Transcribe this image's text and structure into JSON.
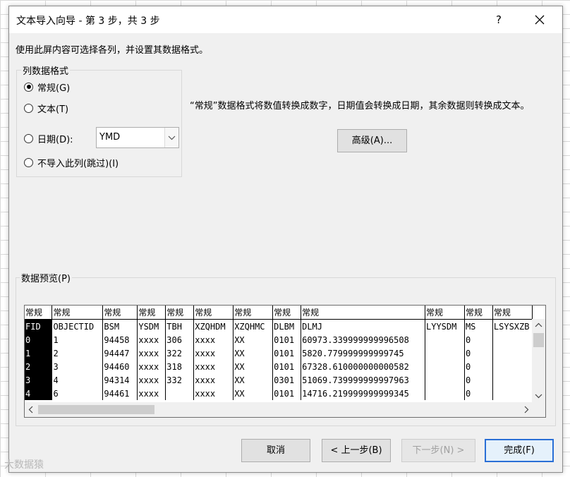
{
  "dialog": {
    "title": "文本导入向导 - 第 3 步，共 3 步",
    "help": "?",
    "intro": "使用此屏内容可选择各列，并设置其数据格式。"
  },
  "format_group": {
    "title": "列数据格式",
    "options": [
      {
        "label": "常规(G)",
        "selected": true
      },
      {
        "label": "文本(T)",
        "selected": false
      },
      {
        "label": "日期(D):",
        "selected": false
      },
      {
        "label": "不导入此列(跳过)(I)",
        "selected": false
      }
    ],
    "date_format": "YMD"
  },
  "description": "“常规”数据格式将数值转换成数字，日期值会转换成日期，其余数据则转换成文本。",
  "advanced_button": "高级(A)...",
  "preview": {
    "title": "数据预览(P)",
    "columns": [
      {
        "type": "常规",
        "name": "FID"
      },
      {
        "type": "常规",
        "name": "OBJECTID"
      },
      {
        "type": "常规",
        "name": "BSM"
      },
      {
        "type": "常规",
        "name": "YSDM"
      },
      {
        "type": "常规",
        "name": "TBH"
      },
      {
        "type": "常规",
        "name": "XZQHDM"
      },
      {
        "type": "常规",
        "name": "XZQHMC"
      },
      {
        "type": "常规",
        "name": "DLBM"
      },
      {
        "type": "常规",
        "name": "DLMJ"
      },
      {
        "type": "常规",
        "name": "LYYSDM"
      },
      {
        "type": "常规",
        "name": "MS"
      },
      {
        "type": "常规",
        "name": "LSYSXZB"
      }
    ],
    "rows": [
      [
        "0",
        "1",
        "94458",
        "xxxx",
        "306",
        "xxxx",
        "XX",
        "0101",
        "60973.339999999996508",
        "",
        "0",
        ""
      ],
      [
        "1",
        "2",
        "94447",
        "xxxx",
        "322",
        "xxxx",
        "XX",
        "0101",
        "5820.779999999999745",
        "",
        "0",
        ""
      ],
      [
        "2",
        "3",
        "94460",
        "xxxx",
        "318",
        "xxxx",
        "XX",
        "0101",
        "67328.610000000000582",
        "",
        "0",
        ""
      ],
      [
        "3",
        "4",
        "94314",
        "xxxx",
        "332",
        "xxxx",
        "XX",
        "0301",
        "51069.739999999997963",
        "",
        "0",
        ""
      ],
      [
        "4",
        "6",
        "94461",
        "xxxx",
        "",
        "xxxx",
        "XX",
        "0101",
        "14716.219999999999345",
        "",
        "0",
        ""
      ]
    ]
  },
  "footer": {
    "cancel": "取消",
    "back": "< 上一步(B)",
    "next": "下一步(N) >",
    "finish": "完成(F)"
  },
  "watermark": "大数据猿"
}
